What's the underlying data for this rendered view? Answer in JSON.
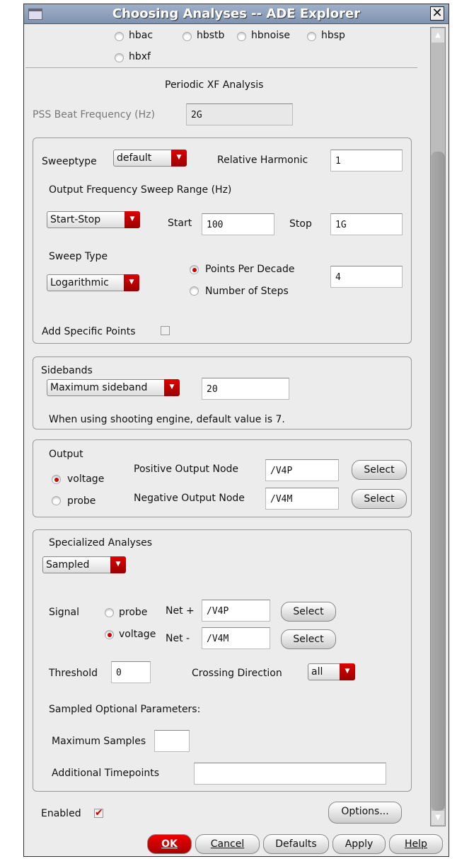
{
  "window": {
    "title": "Choosing Analyses -- ADE Explorer"
  },
  "analyses": [
    "hbac",
    "hbstb",
    "hbnoise",
    "hbsp",
    "hbxf"
  ],
  "section_title": "Periodic XF Analysis",
  "pss": {
    "label": "PSS Beat Frequency (Hz)",
    "value": "2G"
  },
  "sweep": {
    "sweeptype_label": "Sweeptype",
    "sweeptype": "default",
    "rel_harm_label": "Relative Harmonic",
    "rel_harm": "1",
    "range_label": "Output Frequency Sweep Range (Hz)",
    "range_type": "Start-Stop",
    "start_label": "Start",
    "start": "100",
    "stop_label": "Stop",
    "stop": "1G",
    "type_label": "Sweep Type",
    "type": "Logarithmic",
    "ppd_label": "Points Per Decade",
    "steps_label": "Number of Steps",
    "ppd": "4",
    "specific_label": "Add Specific Points"
  },
  "sidebands": {
    "label": "Sidebands",
    "type": "Maximum sideband",
    "value": "20",
    "note": "When using shooting engine, default value is 7."
  },
  "output": {
    "label": "Output",
    "voltage": "voltage",
    "probe": "probe",
    "pos_label": "Positive Output Node",
    "pos": "/V4P",
    "neg_label": "Negative Output Node",
    "neg": "/V4M",
    "select": "Select"
  },
  "special": {
    "label": "Specialized Analyses",
    "type": "Sampled",
    "signal_label": "Signal",
    "probe": "probe",
    "voltage": "voltage",
    "netp_label": "Net +",
    "netp": "/V4P",
    "netm_label": "Net -",
    "netm": "/V4M",
    "select": "Select",
    "threshold_label": "Threshold",
    "threshold": "0",
    "crossing_label": "Crossing Direction",
    "crossing": "all",
    "optional_label": "Sampled Optional Parameters:",
    "max_label": "Maximum Samples",
    "max": "",
    "addl_label": "Additional Timepoints",
    "addl": ""
  },
  "enabled_label": "Enabled",
  "options": "Options...",
  "buttons": {
    "ok": "OK",
    "cancel": "Cancel",
    "defaults": "Defaults",
    "apply": "Apply",
    "help": "Help"
  }
}
